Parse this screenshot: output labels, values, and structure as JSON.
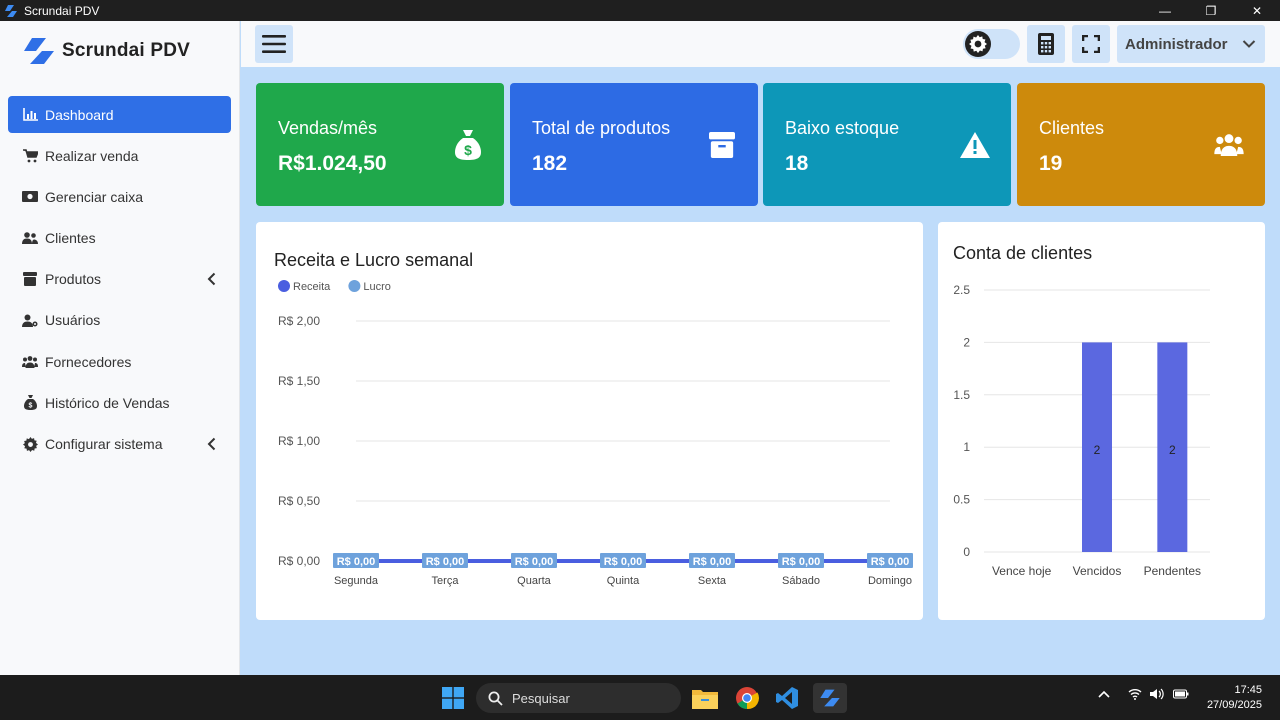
{
  "window": {
    "title": "Scrundai PDV",
    "minimize_glyph": "—",
    "maximize_glyph": "❐",
    "close_glyph": "✕"
  },
  "brand": {
    "name": "Scrundai PDV",
    "color": "#2f6fe6"
  },
  "sidebar": {
    "items": [
      {
        "label": "Dashboard",
        "icon": "chart-bar-icon",
        "active": true
      },
      {
        "label": "Realizar venda",
        "icon": "cart-icon"
      },
      {
        "label": "Gerenciar caixa",
        "icon": "money-bill-icon"
      },
      {
        "label": "Clientes",
        "icon": "users-icon"
      },
      {
        "label": "Produtos",
        "icon": "box-icon",
        "has_submenu": true
      },
      {
        "label": "Usuários",
        "icon": "user-cog-icon"
      },
      {
        "label": "Fornecedores",
        "icon": "people-group-icon"
      },
      {
        "label": "Histórico de Vendas",
        "icon": "money-bag-icon"
      },
      {
        "label": "Configurar sistema",
        "icon": "gear-icon",
        "has_submenu": true
      }
    ]
  },
  "header": {
    "user": "Administrador"
  },
  "stats": [
    {
      "label": "Vendas/mês",
      "value": "R$1.024,50",
      "color": "#1fa84b",
      "icon": "money-bag-icon"
    },
    {
      "label": "Total de produtos",
      "value": "182",
      "color": "#2d6be4",
      "icon": "box-icon"
    },
    {
      "label": "Baixo estoque",
      "value": "18",
      "color": "#0d97b8",
      "icon": "warning-icon"
    },
    {
      "label": "Clientes",
      "value": "19",
      "color": "#cd8a0c",
      "icon": "users-icon"
    }
  ],
  "chart_data": [
    {
      "type": "line",
      "title": "Receita e Lucro semanal",
      "categories": [
        "Segunda",
        "Terça",
        "Quarta",
        "Quinta",
        "Sexta",
        "Sábado",
        "Domingo"
      ],
      "series": [
        {
          "name": "Receita",
          "values": [
            0,
            0,
            0,
            0,
            0,
            0,
            0
          ],
          "color": "#4a5ee0"
        },
        {
          "name": "Lucro",
          "values": [
            0,
            0,
            0,
            0,
            0,
            0,
            0
          ],
          "color": "#6ea2dc"
        }
      ],
      "data_labels": [
        "R$ 0,00",
        "R$ 0,00",
        "R$ 0,00",
        "R$ 0,00",
        "R$ 0,00",
        "R$ 0,00",
        "R$ 0,00"
      ],
      "y_ticks": [
        0,
        0.5,
        1,
        1.5,
        2
      ],
      "y_tick_labels": [
        "R$ 0,00",
        "R$ 0,50",
        "R$ 1,00",
        "R$ 1,50",
        "R$ 2,00"
      ],
      "ylim": [
        0,
        2
      ],
      "legend": "top-left",
      "grid": true
    },
    {
      "type": "bar",
      "title": "Conta de clientes",
      "categories": [
        "Vence hoje",
        "Vencidos",
        "Pendentes"
      ],
      "values": [
        0,
        2,
        2
      ],
      "y_ticks": [
        0,
        0.5,
        1,
        1.5,
        2,
        2.5
      ],
      "y_tick_labels": [
        "0",
        "0.5",
        "1",
        "1.5",
        "2",
        "2.5"
      ],
      "ylim": [
        0,
        2.5
      ],
      "color": "#5b68e0",
      "grid": true
    }
  ],
  "taskbar": {
    "search_placeholder": "Pesquisar",
    "time": "17:45",
    "date": "27/09/2025"
  }
}
